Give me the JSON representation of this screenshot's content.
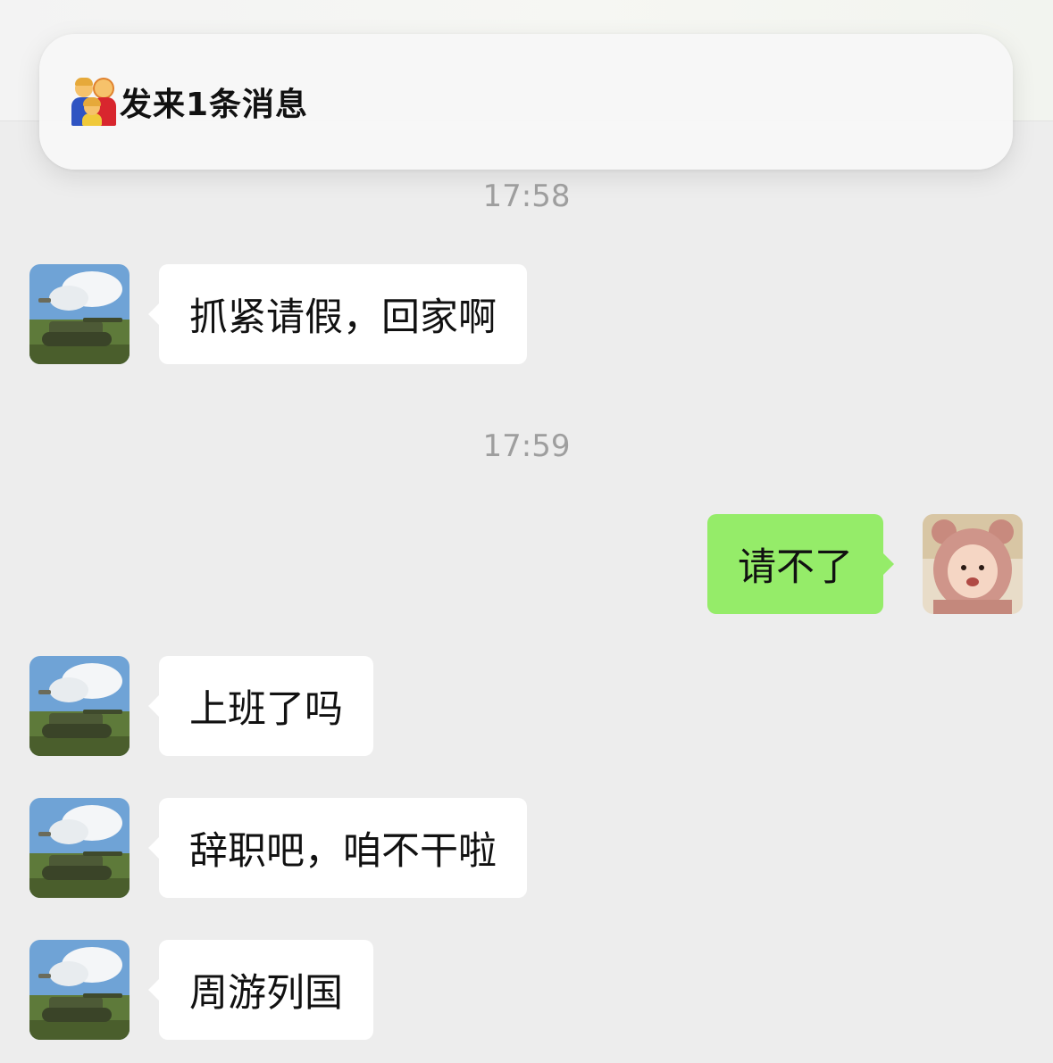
{
  "notification": {
    "icon": "family-emoji-icon",
    "text": "发来1条消息"
  },
  "chat": {
    "bubble_colors": {
      "incoming": "#ffffff",
      "outgoing": "#95ec69"
    },
    "timestamps": [
      "17:58",
      "17:59"
    ],
    "messages": [
      {
        "side": "incoming",
        "sender_avatar": "tank-avatar-icon",
        "text": "抓紧请假，回家啊"
      },
      {
        "side": "outgoing",
        "sender_avatar": "child-bear-hood-avatar-icon",
        "text": "请不了"
      },
      {
        "side": "incoming",
        "sender_avatar": "tank-avatar-icon",
        "text": "上班了吗"
      },
      {
        "side": "incoming",
        "sender_avatar": "tank-avatar-icon",
        "text": "辞职吧，咱不干啦"
      },
      {
        "side": "incoming",
        "sender_avatar": "tank-avatar-icon",
        "text": "周游列国"
      }
    ]
  }
}
